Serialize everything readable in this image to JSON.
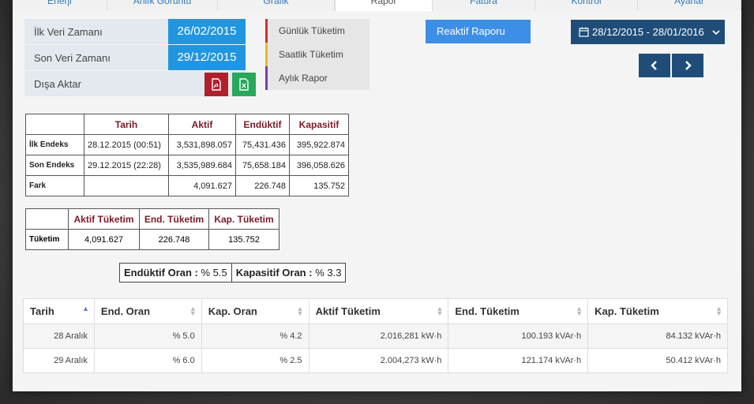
{
  "colors": {
    "primary_blue": "#2196e0",
    "dark_blue": "#1f4d78",
    "pdf_red": "#b0202c",
    "excel_green": "#27a85c",
    "header_red": "#7a1a28",
    "report_gunluk": "#cc3333",
    "report_saatlik": "#e8b833",
    "report_aylik": "#7b3fa0"
  },
  "tabs": [
    {
      "label": "Enerji"
    },
    {
      "label": "Anlık Görüntü"
    },
    {
      "label": "Grafik"
    },
    {
      "label": "Rapor"
    },
    {
      "label": "Fatura"
    },
    {
      "label": "Kontrol"
    },
    {
      "label": "Ayarlar"
    }
  ],
  "info": {
    "first_label": "İlk Veri Zamanı",
    "first_value": "26/02/2015",
    "last_label": "Son Veri Zamanı",
    "last_value": "29/12/2015",
    "export_label": "Dışa Aktar",
    "export_pdf_icon": "pdf-icon",
    "export_xls_icon": "excel-icon"
  },
  "reports": [
    {
      "label": "Günlük Tüketim"
    },
    {
      "label": "Saatlik Tüketim"
    },
    {
      "label": "Aylık Rapor"
    }
  ],
  "reaktif_label": "Reaktif Raporu",
  "date_range": {
    "icon": "calendar-icon",
    "label": "28/12/2015 - 28/01/2016",
    "caret": "chevron-down-icon"
  },
  "nav": {
    "prev_icon": "chevron-left-icon",
    "next_icon": "chevron-right-icon"
  },
  "endeks_table": {
    "headers": [
      "",
      "Tarih",
      "Aktif",
      "Endüktif",
      "Kapasitif"
    ],
    "rows": [
      [
        "İlk Endeks",
        "28.12.2015 (00:51)",
        "3,531,898.057",
        "75,431.436",
        "395,922.874"
      ],
      [
        "Son Endeks",
        "29.12.2015 (22:28)",
        "3,535,989.684",
        "75,658.184",
        "396,058.626"
      ],
      [
        "Fark",
        "",
        "4,091.627",
        "226.748",
        "135.752"
      ]
    ]
  },
  "tuketim_table": {
    "headers": [
      "",
      "Aktif Tüketim",
      "End. Tüketim",
      "Kap. Tüketim"
    ],
    "rows": [
      [
        "Tüketim",
        "4,091.627",
        "226.748",
        "135.752"
      ]
    ]
  },
  "oran": {
    "enduktif_label": "Endüktif Oran :",
    "enduktif_value": "% 5.5",
    "kapasitif_label": "Kapasitif Oran :",
    "kapasitif_value": "% 3.3"
  },
  "daily_table": {
    "headers": [
      "Tarih",
      "End. Oran",
      "Kap. Oran",
      "Aktif Tüketim",
      "End. Tüketim",
      "Kap. Tüketim"
    ],
    "rows": [
      [
        "28 Aralık",
        "% 5.0",
        "% 4.2",
        "2.016,281 kW·h",
        "100.193 kVAr·h",
        "84.132 kVAr·h"
      ],
      [
        "29 Aralık",
        "% 6.0",
        "% 2.5",
        "2.004,273 kW·h",
        "121.174 kVAr·h",
        "50.412 kVAr·h"
      ]
    ]
  }
}
